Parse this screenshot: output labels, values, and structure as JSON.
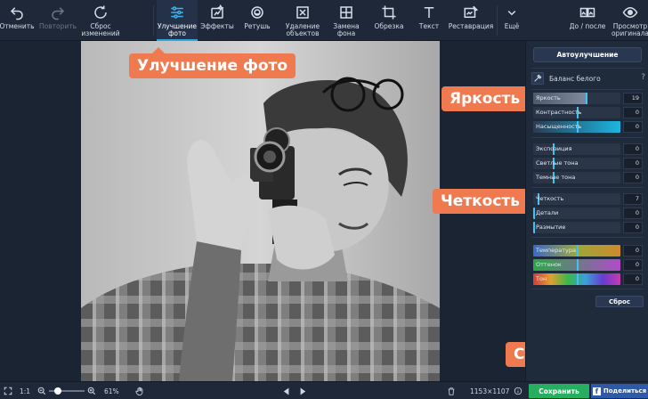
{
  "toolbar": {
    "undo": "Отменить",
    "redo": "Повторить",
    "reset": "Сброс\nизменений",
    "enhance": "Улучшение\nфото",
    "effects": "Эффекты",
    "retouch": "Ретушь",
    "remove_objects": "Удаление\nобъектов",
    "replace_bg": "Замена\nфона",
    "crop": "Обрезка",
    "text": "Текст",
    "restoration": "Реставрация",
    "more": "Ещё",
    "before_after": "До / после",
    "view_original": "Просмотр\nоригинала"
  },
  "callouts": {
    "enhance": "Улучшение фото",
    "brightness": "Яркость",
    "sharpness": "Четкость",
    "save": "Сохранить"
  },
  "panel": {
    "auto_label": "Автоулучшение",
    "white_balance": "Баланс белого",
    "help": "?",
    "reset_label": "Сброс",
    "sliders": [
      {
        "label": "Яркость",
        "value": "19",
        "level": 0.6
      },
      {
        "label": "Контрастность",
        "value": "0",
        "level": 0.5
      },
      {
        "label": "Насыщенность",
        "value": "0",
        "level": 0.5
      },
      {
        "label": "Экспозиция",
        "value": "0",
        "level": 0.22
      },
      {
        "label": "Светлые тона",
        "value": "0",
        "level": 0.22
      },
      {
        "label": "Темные тона",
        "value": "0",
        "level": 0.22
      },
      {
        "label": "Четкость",
        "value": "7",
        "level": 0.05
      },
      {
        "label": "Детали",
        "value": "0",
        "level": 0.0
      },
      {
        "label": "Размытие",
        "value": "0",
        "level": 0.0
      },
      {
        "label": "Температура",
        "value": "0",
        "level": 0.5
      },
      {
        "label": "Оттенок",
        "value": "0",
        "level": 0.5
      },
      {
        "label": "Тон",
        "value": "0",
        "level": 0.5
      }
    ]
  },
  "bottom": {
    "fit": "1:1",
    "zoom": "61%",
    "dimensions": "1153×1107",
    "save_label": "Сохранить",
    "share_label": "Поделиться"
  },
  "colors": {
    "accent": "#2da5de",
    "callout": "#f07a4f",
    "save": "#27ae60",
    "share": "#2f5aa8"
  }
}
